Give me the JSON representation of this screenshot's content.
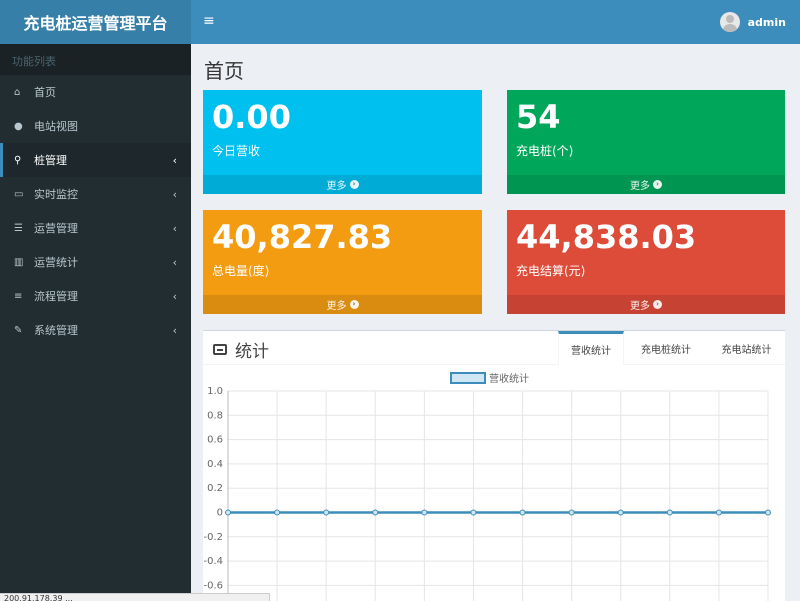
{
  "app": {
    "title": "充电桩运营管理平台",
    "user": "admin"
  },
  "sidebar": {
    "header": "功能列表",
    "items": [
      {
        "label": "首页",
        "icon": "home-icon",
        "glyph": "⌂",
        "has_children": false
      },
      {
        "label": "电站视图",
        "icon": "circle-icon",
        "glyph": "●",
        "has_children": false
      },
      {
        "label": "桩管理",
        "icon": "map-marker-icon",
        "glyph": "⚲",
        "has_children": true,
        "active": true
      },
      {
        "label": "实时监控",
        "icon": "monitor-icon",
        "glyph": "▭",
        "has_children": true
      },
      {
        "label": "运营管理",
        "icon": "database-icon",
        "glyph": "☰",
        "has_children": true
      },
      {
        "label": "运营统计",
        "icon": "bar-chart-icon",
        "glyph": "▥",
        "has_children": true
      },
      {
        "label": "流程管理",
        "icon": "sliders-icon",
        "glyph": "≡",
        "has_children": true
      },
      {
        "label": "系统管理",
        "icon": "wrench-icon",
        "glyph": "✎",
        "has_children": true
      }
    ],
    "chevron": "‹"
  },
  "page": {
    "title": "首页"
  },
  "info_boxes": [
    {
      "value": "0.00",
      "label": "今日营收",
      "more": "更多",
      "color": "#00c0ef"
    },
    {
      "value": "54",
      "label": "充电桩(个)",
      "more": "更多",
      "color": "#00a65a"
    },
    {
      "value": "40,827.83",
      "label": "总电量(度)",
      "more": "更多",
      "color": "#f39c12"
    },
    {
      "value": "44,838.03",
      "label": "充电结算(元)",
      "more": "更多",
      "color": "#dd4b39"
    }
  ],
  "stats_panel": {
    "title": "统计",
    "tabs": [
      {
        "label": "营收统计",
        "active": true
      },
      {
        "label": "充电桩统计",
        "active": false
      },
      {
        "label": "充电站统计",
        "active": false
      }
    ]
  },
  "chart_data": {
    "type": "line",
    "series": [
      {
        "name": "营收统计",
        "values": [
          0,
          0,
          0,
          0,
          0,
          0,
          0,
          0,
          0,
          0,
          0,
          0
        ]
      }
    ],
    "y_ticks": [
      "1.0",
      "0.8",
      "0.6",
      "0.4",
      "0.2",
      "0",
      "-0.2",
      "-0.4",
      "-0.6"
    ],
    "ylim": [
      -0.6,
      1.0
    ],
    "grid": true,
    "legend": "top-center",
    "line_color": "#3c8dbc"
  },
  "statusbar": {
    "text": "200.91.178.39 ..."
  },
  "colors": {
    "header": "#3c8dbc",
    "logo": "#367fa9",
    "sidebar": "#222d32"
  }
}
